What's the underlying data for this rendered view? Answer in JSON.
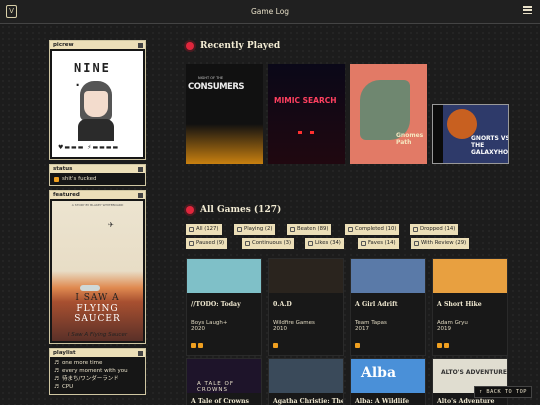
{
  "topbar": {
    "title": "Game Log",
    "logo": "V"
  },
  "sidebar": {
    "picrew": {
      "title": "picrew",
      "name": "NINE ..."
    },
    "status": {
      "title": "status",
      "text": "shit's fucked"
    },
    "featured": {
      "title": "featured",
      "top": "A STORY BY BLAKEY WHITEBOARD",
      "line1": "I SAW A",
      "line2": "FLYING SAUCER",
      "caption": "I Saw A Flying Saucer"
    },
    "playlist": {
      "title": "playlist",
      "items": [
        "one more time",
        "every moment with you",
        "待まち/ワンダーランド",
        "CPU"
      ]
    }
  },
  "recent": {
    "title": "Recently Played",
    "covers": [
      {
        "name": "Night of the Consumers",
        "text": "CONSUMERS",
        "sub": "NIGHT OF THE"
      },
      {
        "name": "Mimic Search",
        "text": "MIMIC SEARCH"
      },
      {
        "name": "Gnome's Path",
        "text": "Gnomes Path"
      },
      {
        "name": "Gnorts vs the Galaxyholes",
        "text": "GNORTS VS THE GALAXYHOLES"
      }
    ]
  },
  "allgames": {
    "title": "All Games (127)",
    "filters": [
      "All (127)",
      "Playing (2)",
      "Beaten (89)",
      "Completed (10)",
      "Dropped (14)",
      "Paused (9)",
      "Continuous (3)",
      "Likes (34)",
      "Faves (14)",
      "With Review (29)"
    ],
    "cards": [
      {
        "name": "//TODO: Today",
        "dev": "Boys Laugh+",
        "year": "2020",
        "color": "#7fc0c8"
      },
      {
        "name": "0.A.D",
        "dev": "Wildfire Games",
        "year": "2010",
        "color": "#2a241e"
      },
      {
        "name": "A Girl Adrift",
        "dev": "Team Tapas",
        "year": "2017",
        "color": "#5a7aa8"
      },
      {
        "name": "A Short Hike",
        "dev": "Adam Gryu",
        "year": "2019",
        "color": "#e8a040"
      },
      {
        "name": "A Tale of Crowns",
        "color": "#1e142a",
        "banner": "A TALE OF CROWNS"
      },
      {
        "name": "Agatha Christie: The",
        "color": "#3a4a5a"
      },
      {
        "name": "Alba: A Wildlife",
        "color": "#4a90d8",
        "banner": "Alba"
      },
      {
        "name": "Alto's Adventure",
        "color": "#e0ddd0",
        "banner": "ALTO'S ADVENTURE"
      }
    ]
  },
  "back_to_top": "↑ BACK TO TOP"
}
